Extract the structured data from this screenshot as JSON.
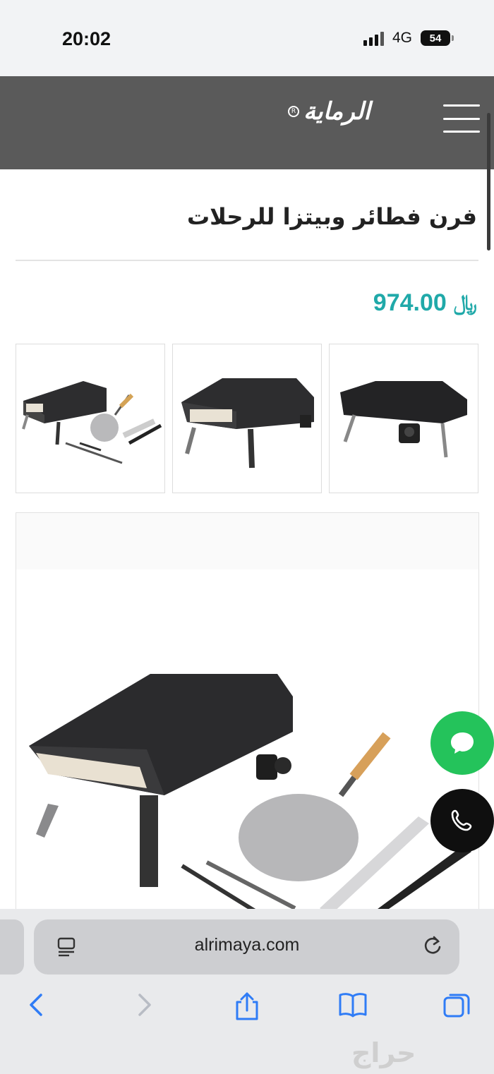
{
  "status_bar": {
    "time": "20:02",
    "network": "4G",
    "battery": "54"
  },
  "header": {
    "logo_text": "الرماية",
    "logo_mark": "R"
  },
  "product": {
    "title": "فرن فطائر وبيتزا للرحلات",
    "price": "974.00",
    "currency_symbol": "﷼"
  },
  "gallery": {
    "thumbnails": [
      "oven-with-accessories",
      "oven-front",
      "oven-side"
    ],
    "main": "oven-with-accessories"
  },
  "floating": {
    "chat": "chat-icon",
    "call": "phone-icon"
  },
  "browser": {
    "url": "alrimaya.com",
    "toolbar": [
      "back-icon",
      "forward-icon",
      "share-icon",
      "bookmarks-icon",
      "tabs-icon"
    ]
  },
  "watermark": "حراج",
  "colors": {
    "header": "#5a5a5a",
    "price": "#20a9a9",
    "chat": "#24c35b",
    "call": "#0f0f0f",
    "link_blue": "#2f7cf6"
  }
}
